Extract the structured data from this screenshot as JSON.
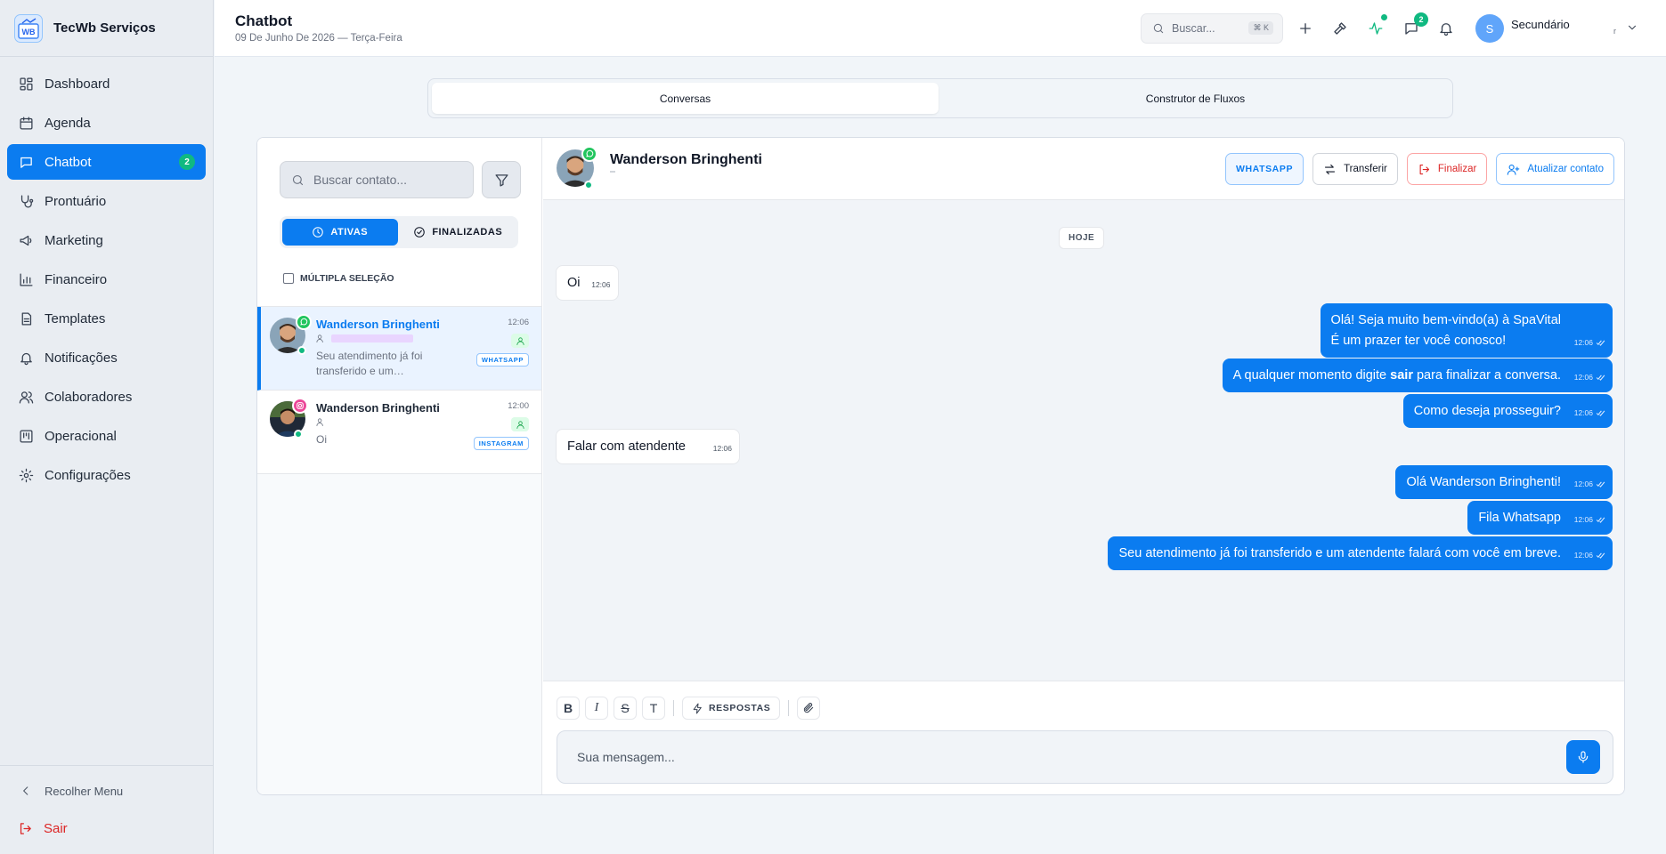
{
  "brand": {
    "name": "TecWb Serviços",
    "logo_text": "WB"
  },
  "sidebar": {
    "items": [
      {
        "label": "Dashboard",
        "icon": "dashboard-icon"
      },
      {
        "label": "Agenda",
        "icon": "calendar-icon"
      },
      {
        "label": "Chatbot",
        "icon": "chat-icon",
        "badge": "2",
        "active": true
      },
      {
        "label": "Prontuário",
        "icon": "stethoscope-icon"
      },
      {
        "label": "Marketing",
        "icon": "megaphone-icon"
      },
      {
        "label": "Financeiro",
        "icon": "bar-chart-icon"
      },
      {
        "label": "Templates",
        "icon": "document-icon"
      },
      {
        "label": "Notificações",
        "icon": "bell-icon"
      },
      {
        "label": "Colaboradores",
        "icon": "users-icon"
      },
      {
        "label": "Operacional",
        "icon": "kanban-icon"
      },
      {
        "label": "Configurações",
        "icon": "gear-icon"
      }
    ],
    "collapse_label": "Recolher Menu",
    "logout_label": "Sair"
  },
  "header": {
    "title": "Chatbot",
    "date": "09 De Junho De 2026 — Terça-Feira",
    "search_placeholder": "Buscar...",
    "search_shortcut": "⌘ K",
    "messages_badge": "2",
    "user_initial": "S",
    "user_name": "Secundário",
    "user_subtext": "r"
  },
  "tabs": [
    {
      "label": "Conversas",
      "active": true
    },
    {
      "label": "Construtor de Fluxos",
      "active": false
    }
  ],
  "contacts": {
    "search_placeholder": "Buscar contato...",
    "filter_active": "ATIVAS",
    "filter_finished": "FINALIZADAS",
    "multi_select_label": "MÚLTIPLA SELEÇÃO",
    "list": [
      {
        "name": "Wanderson Bringhenti",
        "time": "12:06",
        "preview": "Seu atendimento já foi transferido e um…",
        "channel": "WHATSAPP",
        "selected": true
      },
      {
        "name": "Wanderson Bringhenti",
        "time": "12:00",
        "preview": "Oi",
        "channel": "INSTAGRAM",
        "selected": false
      }
    ]
  },
  "chat": {
    "contact_name": "Wanderson Bringhenti",
    "channel_button": "WHATSAPP",
    "transfer_button": "Transferir",
    "finish_button": "Finalizar",
    "update_button": "Atualizar contato",
    "day_label": "HOJE",
    "messages": [
      {
        "dir": "in",
        "text": "Oi",
        "time": "12:06"
      },
      {
        "dir": "out",
        "line1": "Olá! Seja muito bem-vindo(a) à SpaVital",
        "line2": "É um prazer ter você conosco!",
        "time": "12:06"
      },
      {
        "dir": "out",
        "before": "A qualquer momento digite ",
        "bold": "sair",
        "after": " para finalizar a conversa.",
        "time": "12:06"
      },
      {
        "dir": "out",
        "text": "Como deseja prosseguir?",
        "time": "12:06"
      },
      {
        "dir": "in",
        "text": "Falar com atendente",
        "time": "12:06"
      },
      {
        "dir": "out",
        "text": "Olá Wanderson Bringhenti!",
        "time": "12:06"
      },
      {
        "dir": "out",
        "text": "Fila Whatsapp",
        "time": "12:06"
      },
      {
        "dir": "out",
        "text": "Seu atendimento já foi transferido e um atendente falará com você em breve.",
        "time": "12:06"
      }
    ],
    "composer": {
      "bold": "B",
      "italic": "I",
      "strike": "S",
      "text_tool": "T",
      "responses_label": "RESPOSTAS",
      "placeholder": "Sua mensagem..."
    }
  },
  "colors": {
    "primary": "#0b7cf0",
    "success": "#10b981",
    "danger": "#dc2626",
    "instagram": "#ec4899"
  }
}
